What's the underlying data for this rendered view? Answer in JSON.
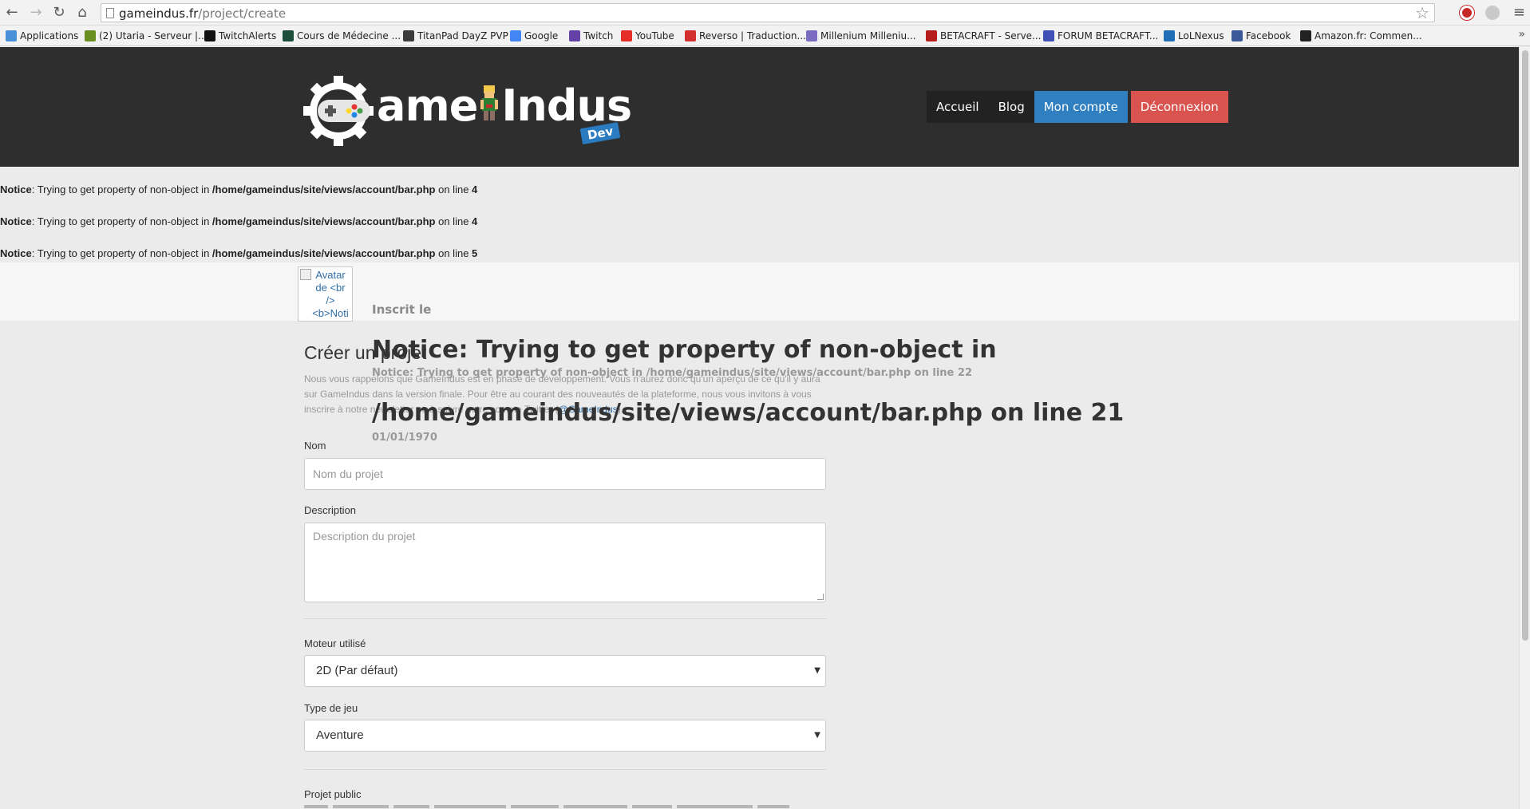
{
  "browser": {
    "url_domain": "gameindus.fr",
    "url_path": "/project/create",
    "bookmarks": [
      {
        "label": "Applications",
        "color": "#4a90d9"
      },
      {
        "label": "(2) Utaria - Serveur |...",
        "color": "#6b8e23"
      },
      {
        "label": "TwitchAlerts",
        "color": "#111111"
      },
      {
        "label": "Cours de Médecine ...",
        "color": "#1c4d3a"
      },
      {
        "label": "TitanPad DayZ PVP",
        "color": "#3a3a3a"
      },
      {
        "label": "Google",
        "color": "#4285f4"
      },
      {
        "label": "Twitch",
        "color": "#6441a5"
      },
      {
        "label": "YouTube",
        "color": "#e52d27"
      },
      {
        "label": "Reverso | Traduction...",
        "color": "#d32f2f"
      },
      {
        "label": "Millenium Milleniu...",
        "color": "#7b6cc1"
      },
      {
        "label": "BETACRAFT - Serve...",
        "color": "#b71c1c"
      },
      {
        "label": "FORUM BETACRAFT...",
        "color": "#3f51b5"
      },
      {
        "label": "LoLNexus",
        "color": "#1e6fb5"
      },
      {
        "label": "Facebook",
        "color": "#3b5998"
      },
      {
        "label": "Amazon.fr: Commen...",
        "color": "#222222"
      }
    ]
  },
  "site": {
    "logo_text": "ame",
    "logo_text2": "Indus",
    "logo_badge": "Dev",
    "nav": {
      "home": "Accueil",
      "blog": "Blog",
      "account": "Mon compte",
      "logout": "Déconnexion"
    },
    "colors": {
      "header_bg": "#2e2e2e",
      "account_btn": "#2f7fc1",
      "logout_btn": "#d9534f"
    }
  },
  "notices": [
    {
      "label": "Notice",
      "message": ": Trying to get property of non-object in ",
      "file": "/home/gameindus/site/views/account/bar.php",
      "on_line": " on line ",
      "line": "4"
    },
    {
      "label": "Notice",
      "message": ": Trying to get property of non-object in ",
      "file": "/home/gameindus/site/views/account/bar.php",
      "on_line": " on line ",
      "line": "4"
    },
    {
      "label": "Notice",
      "message": ": Trying to get property of non-object in ",
      "file": "/home/gameindus/site/views/account/bar.php",
      "on_line": " on line ",
      "line": "5"
    }
  ],
  "account_bar": {
    "avatar_alt": "Avatar de <br /> <b>Noti",
    "inscrit_label": "Inscrit le",
    "big_notice_1": "Notice: Trying to get property of non-object in",
    "small_notice": "Notice: Trying to get property of non-object in /home/gameindus/site/views/account/bar.php on line 22",
    "big_notice_2": "/home/gameindus/site/views/account/bar.php on line 21",
    "date": "01/01/1970"
  },
  "form": {
    "title": "Créer un projet",
    "intro": "Nous vous rappelons que GameIndus est en phase de développement. Vous n'aurez donc qu'un aperçu de ce qu'il y aura sur GameIndus dans la version finale. Pour être au courant des nouveautés de la plateforme, nous vous invitons à vous inscrire à notre newsletter ou à suivre notre compte Twitter (",
    "intro_link": "@GameIndus",
    "intro_end": ").",
    "name_label": "Nom",
    "name_placeholder": "Nom du projet",
    "description_label": "Description",
    "description_placeholder": "Description du projet",
    "engine_label": "Moteur utilisé",
    "engine_value": "2D (Par défaut)",
    "type_label": "Type de jeu",
    "type_value": "Aventure",
    "public_label": "Projet public"
  }
}
